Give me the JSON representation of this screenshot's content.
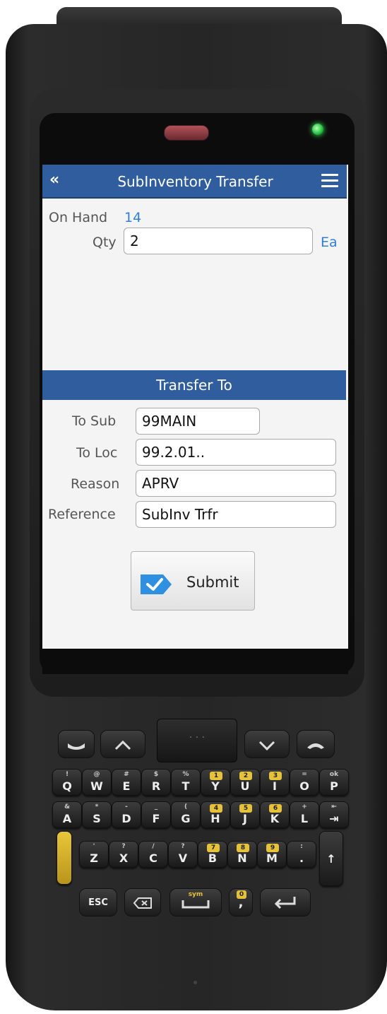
{
  "app": {
    "title": "SubInventory Transfer",
    "back_icon": "double-chevron-left-icon",
    "menu_icon": "hamburger-menu-icon",
    "accent": "#2f5d9e",
    "link_color": "#2f7ed8"
  },
  "item": {
    "on_hand_label": "On Hand",
    "on_hand_value": "14",
    "qty_label": "Qty",
    "qty_value": "2",
    "uom": "Ea"
  },
  "section": {
    "title": "Transfer To"
  },
  "transfer": {
    "to_sub_label": "To Sub",
    "to_sub_value": "99MAIN",
    "to_loc_label": "To Loc",
    "to_loc_value": "99.2.01..",
    "reason_label": "Reason",
    "reason_value": "APRV",
    "reference_label": "Reference",
    "reference_value": "SubInv Trfr"
  },
  "actions": {
    "submit_label": "Submit",
    "submit_icon": "checkmark-tag-icon"
  },
  "keypad": {
    "row1": [
      {
        "main": "Q",
        "sym": "!"
      },
      {
        "main": "W",
        "sym": "@"
      },
      {
        "main": "E",
        "sym": "#"
      },
      {
        "main": "R",
        "sym": "$"
      },
      {
        "main": "T",
        "sym": "%"
      },
      {
        "main": "Y",
        "sym": "1"
      },
      {
        "main": "U",
        "sym": "2"
      },
      {
        "main": "I",
        "sym": "3"
      },
      {
        "main": "O",
        "sym": "="
      },
      {
        "main": "P",
        "sym": "ok"
      }
    ],
    "row2": [
      {
        "main": "A",
        "sym": "&"
      },
      {
        "main": "S",
        "sym": "*"
      },
      {
        "main": "D",
        "sym": "-"
      },
      {
        "main": "F",
        "sym": "_"
      },
      {
        "main": "G",
        "sym": "("
      },
      {
        "main": "H",
        "sym": "4"
      },
      {
        "main": "J",
        "sym": "5"
      },
      {
        "main": "K",
        "sym": "6"
      },
      {
        "main": "L",
        "sym": "+"
      },
      {
        "main": "⇥",
        "sym": "⇤"
      }
    ],
    "row3": [
      {
        "main": "Z",
        "sym": "'"
      },
      {
        "main": "X",
        "sym": "?"
      },
      {
        "main": "C",
        "sym": "/"
      },
      {
        "main": "V",
        "sym": "?"
      },
      {
        "main": "B",
        "sym": "7"
      },
      {
        "main": "N",
        "sym": "8"
      },
      {
        "main": "M",
        "sym": "9"
      },
      {
        "main": ".",
        "sym": ":"
      }
    ],
    "esc": "ESC",
    "sym": "sym",
    "zero_sym": "0"
  }
}
